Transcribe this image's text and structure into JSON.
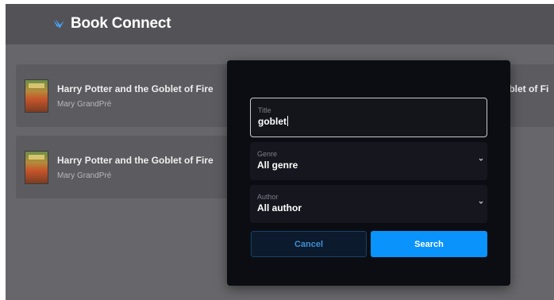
{
  "app": {
    "title": "Book Connect",
    "logo_icon": "wing-icon"
  },
  "books": [
    {
      "title": "Harry Potter and the Goblet of Fire",
      "author": "Mary GrandPré"
    },
    {
      "title": "Harry Potter and the Goblet of Fire",
      "author": "Mary GrandPré"
    },
    {
      "title": "oblet of Fi",
      "author": ""
    }
  ],
  "search": {
    "title_label": "Title",
    "title_value": "goblet",
    "genre_label": "Genre",
    "genre_value": "All genre",
    "author_label": "Author",
    "author_value": "All author",
    "cancel_label": "Cancel",
    "search_label": "Search"
  },
  "colors": {
    "accent": "#0a93fb",
    "overlay": "#67676b",
    "modal": "#0c0d13"
  }
}
